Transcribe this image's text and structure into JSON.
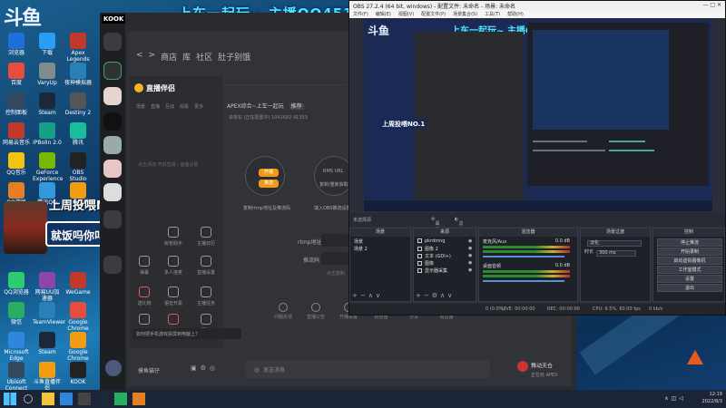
{
  "overlay": {
    "logo_text": "斗鱼",
    "banner": "上车一起玩~ 主播QQ451685315 入",
    "promo_line1": "上周投喂NO.1",
    "promo_line2": "就饭吗你叫夏洛呀"
  },
  "desktop_icons": [
    {
      "label": "浏览器",
      "color": "#1e6fd9"
    },
    {
      "label": "下载",
      "color": "#2a9df4"
    },
    {
      "label": "Apex Legends",
      "color": "#c0392b"
    },
    {
      "label": "百度",
      "color": "#e74c3c"
    },
    {
      "label": "VaryUp",
      "color": "#7f8c8d"
    },
    {
      "label": "夜神模拟器",
      "color": "#2980b9"
    },
    {
      "label": "控制面板",
      "color": "#34495e"
    },
    {
      "label": "Steam",
      "color": "#1b2838"
    },
    {
      "label": "Destiny 2",
      "color": "#555"
    },
    {
      "label": "网易云音乐",
      "color": "#c0392b"
    },
    {
      "label": "iPBolin 2.0",
      "color": "#16a085"
    },
    {
      "label": "腾讯",
      "color": "#1abc9c"
    },
    {
      "label": "QQ音乐",
      "color": "#f1c40f"
    },
    {
      "label": "GeForce Experience",
      "color": "#76b900"
    },
    {
      "label": "OBS Studio",
      "color": "#222"
    },
    {
      "label": "QQ游戏",
      "color": "#e67e22"
    },
    {
      "label": "腾讯QQ",
      "color": "#3498db"
    },
    {
      "label": "斗鱼直播",
      "color": "#f39c12"
    },
    {
      "label": "QQ浏览器",
      "color": "#2ecc71"
    },
    {
      "label": "网易UU加速器",
      "color": "#8e44ad"
    },
    {
      "label": "WeGame",
      "color": "#c0392b"
    },
    {
      "label": "微信",
      "color": "#27ae60"
    },
    {
      "label": "TeamViewer",
      "color": "#2980b9"
    },
    {
      "label": "Google Chrome",
      "color": "#e74c3c"
    },
    {
      "label": "Microsoft Edge",
      "color": "#2e86de"
    },
    {
      "label": "Steam",
      "color": "#1b2838"
    },
    {
      "label": "Google Chrome",
      "color": "#f39c12"
    },
    {
      "label": "Ubisoft Connect",
      "color": "#34495e"
    },
    {
      "label": "斗鱼直播伴侣",
      "color": "#f39c12"
    },
    {
      "label": "KOOK",
      "color": "#222"
    },
    {
      "label": "网易UU",
      "color": "#27ae60"
    }
  ],
  "kook": {
    "logo": "KOOK",
    "nav": [
      "商店",
      "库",
      "社区",
      "肚子别饿"
    ],
    "nav_back": "<",
    "nav_forward": ">",
    "tab_home": "主页",
    "app_name": "直播伴侣",
    "panel_tabs": [
      "场景",
      "直播",
      "互动",
      "观看",
      "更多"
    ],
    "panel_desc": "点击添加 开启直播 / 画面设置",
    "grid": [
      {
        "label": "房管助手"
      },
      {
        "label": "主播日历"
      },
      {
        "label": "弹幕"
      },
      {
        "label": "多人连麦"
      },
      {
        "label": "直播设置"
      },
      {
        "label": "送礼物"
      },
      {
        "label": "语音开黑"
      },
      {
        "label": "主播任务"
      },
      {
        "label": "人气"
      },
      {
        "label": "礼物"
      },
      {
        "label": "更多"
      }
    ],
    "game_title": "APEX综合~上车一起玩",
    "game_tag": "推荐",
    "game_sub_1": "单排车",
    "game_sub_2": "(正在配置中)",
    "game_sub_3": "1041682",
    "game_sub_4": "41353",
    "chip_1": "开播",
    "chip_2": "推流",
    "flow_label_1": "复制rtmp地址及推流码",
    "flow_circle_title": "RMS URL",
    "flow_circle_sub": "复制/重新获取",
    "flow_label_2": "填入OBS推流设置",
    "field_rtmp": "rtmp地址",
    "field_key": "推流码",
    "field_copy": "点击复制",
    "bottom_actions": [
      "问题反馈",
      "直播公告",
      "开播设置",
      "粉丝团",
      "分享",
      "看直播"
    ],
    "notice": "如何把手机游戏投屏到电脑上？",
    "user_name": "摸鱼猫仔",
    "message_placeholder": "发送消息",
    "voice_user": "舞动天仓",
    "voice_status": "正在玩 APEX"
  },
  "obs": {
    "title": "OBS 27.2.4 (64 bit, windows) - 配置文件: 未命名 - 场景: 未命名",
    "menu": [
      "文件(F)",
      "编辑(E)",
      "视图(V)",
      "配置文件(P)",
      "场景集合(S)",
      "工具(T)",
      "帮助(H)"
    ],
    "scene_none": "未选择源",
    "properties_btn": "属性",
    "filters_btn": "滤镜",
    "docks": {
      "scenes": "场景",
      "sources": "来源",
      "mixer": "混音器",
      "transitions": "场景过渡",
      "controls": "控制"
    },
    "scenes": [
      "场景",
      "场景 2"
    ],
    "sources": [
      "pkrdmng",
      "图像 2",
      "文本 (GDI+)",
      "图像",
      "显示器采集"
    ],
    "mixer": [
      {
        "name": "麦克风/Aux",
        "db": "0.0 dB"
      },
      {
        "name": "桌面音频",
        "db": "0.0 dB"
      }
    ],
    "transition_name": "淡化",
    "transition_duration_label": "时长",
    "transition_duration": "300 ms",
    "controls": [
      "停止推流",
      "开始录制",
      "启动虚拟摄像机",
      "工作室模式",
      "设置",
      "退出"
    ],
    "status": {
      "live": "LIVE: 00:00:00",
      "rec": "REC: 00:00:00",
      "cpu": "CPU: 6.5%, 60.00 fps",
      "dropped": "0 (0.0%)",
      "bitrate": "0 kb/s"
    }
  },
  "taskbar": {
    "time": "12:19",
    "date": "2022/8/3"
  }
}
